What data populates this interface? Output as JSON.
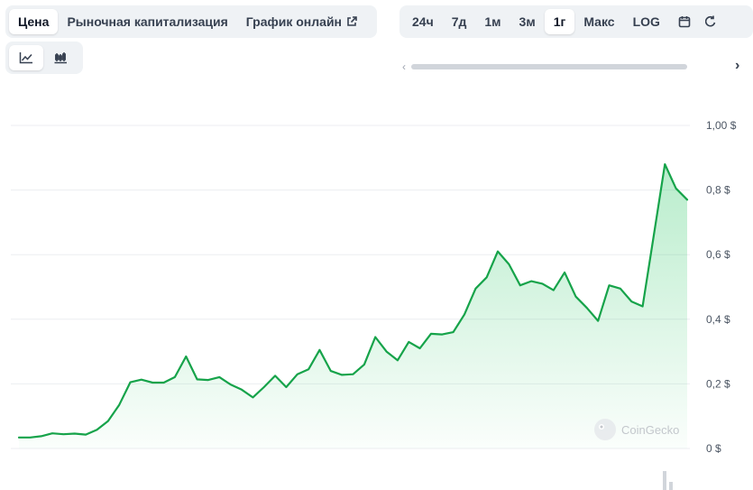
{
  "tabs_left": [
    {
      "label": "Цена",
      "active": true
    },
    {
      "label": "Рыночная капитализация",
      "active": false
    },
    {
      "label": "График онлайн",
      "active": false,
      "icon": "external-link-icon"
    }
  ],
  "tabs_right": [
    {
      "label": "24ч",
      "active": false
    },
    {
      "label": "7д",
      "active": false
    },
    {
      "label": "1м",
      "active": false
    },
    {
      "label": "3м",
      "active": false
    },
    {
      "label": "1г",
      "active": true
    },
    {
      "label": "Макс",
      "active": false
    },
    {
      "label": "LOG",
      "active": false
    }
  ],
  "icons": {
    "line_chart": "line-chart-icon",
    "candle_chart": "candlestick-chart-icon",
    "calendar": "calendar-icon",
    "scroll_left": "chevron-left-icon",
    "scroll_right": "chevron-right-icon"
  },
  "watermark": "CoinGecko",
  "colors": {
    "line": "#16a34a",
    "fill_top": "#22c55e",
    "grid": "#eceef1",
    "toggle_bg": "#eff2f5"
  },
  "chart_data": {
    "type": "area",
    "ylim": [
      0,
      1.0
    ],
    "yticks": [
      0,
      0.2,
      0.4,
      0.6,
      0.8,
      1.0
    ],
    "ytick_labels": [
      "0 $",
      "0,2 $",
      "0,4 $",
      "0,6 $",
      "0,8 $",
      "1,00 $"
    ],
    "axis_position": "right",
    "grid": true,
    "values": [
      0.034,
      0.034,
      0.038,
      0.047,
      0.044,
      0.046,
      0.043,
      0.058,
      0.085,
      0.135,
      0.205,
      0.213,
      0.204,
      0.204,
      0.221,
      0.285,
      0.214,
      0.212,
      0.221,
      0.198,
      0.182,
      0.158,
      0.19,
      0.225,
      0.19,
      0.23,
      0.245,
      0.305,
      0.24,
      0.228,
      0.23,
      0.26,
      0.345,
      0.3,
      0.273,
      0.33,
      0.31,
      0.355,
      0.353,
      0.36,
      0.415,
      0.495,
      0.53,
      0.61,
      0.57,
      0.505,
      0.518,
      0.51,
      0.49,
      0.545,
      0.47,
      0.435,
      0.395,
      0.505,
      0.495,
      0.455,
      0.44,
      0.66,
      0.88,
      0.805,
      0.77
    ]
  }
}
